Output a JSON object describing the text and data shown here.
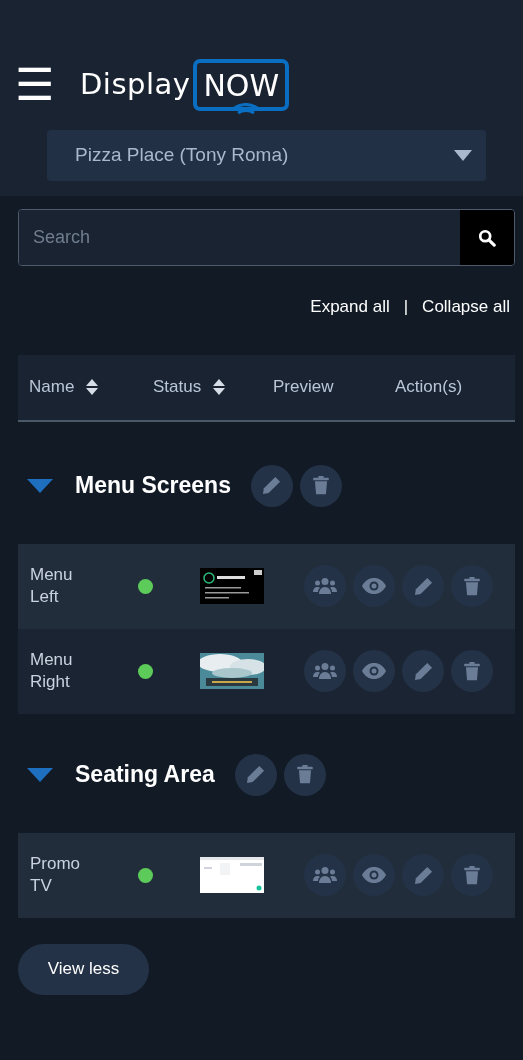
{
  "header": {
    "menu_icon": "☰",
    "logo": {
      "word": "Display",
      "badge": "NOW"
    },
    "location_select": {
      "value": "Pizza Place (Tony Roma)"
    }
  },
  "search": {
    "placeholder": "Search"
  },
  "tree_controls": {
    "expand": "Expand all",
    "separator": "|",
    "collapse": "Collapse all"
  },
  "table": {
    "columns": [
      {
        "label": "Name",
        "sortable": true
      },
      {
        "label": "Status",
        "sortable": true
      },
      {
        "label": "Preview",
        "sortable": false
      },
      {
        "label": "Action(s)",
        "sortable": false
      }
    ],
    "groups": [
      {
        "name": "Menu Screens",
        "expanded": true,
        "rows": [
          {
            "name": "Menu Left",
            "online": true
          },
          {
            "name": "Menu Right",
            "online": true
          }
        ]
      },
      {
        "name": "Seating Area",
        "expanded": true,
        "rows": [
          {
            "name": "Promo TV",
            "online": true
          }
        ]
      }
    ]
  },
  "footer_button": "View less"
}
